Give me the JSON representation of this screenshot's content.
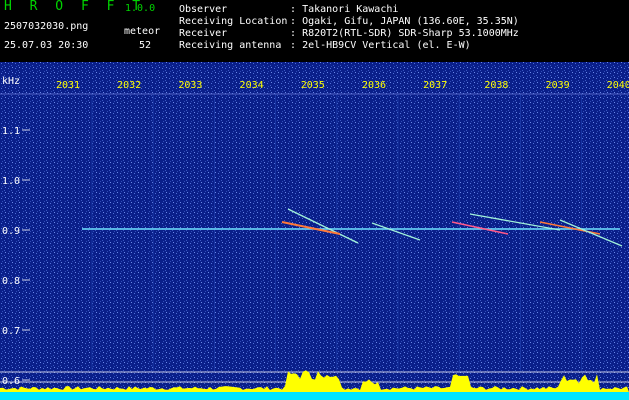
{
  "header": {
    "app_title": "H R O F F T",
    "version": "1.0.0",
    "filename": "2507032030.png",
    "datetime": "25.07.03 20:30",
    "meteor_label": "meteor",
    "meteor_count": "52",
    "info": [
      {
        "label": "Observer",
        "sep": ":",
        "value": "Takanori Kawachi"
      },
      {
        "label": "Receiving Location",
        "sep": ":",
        "value": "Ogaki, Gifu, JAPAN (136.60E, 35.35N)"
      },
      {
        "label": "Receiver",
        "sep": ":",
        "value": "R820T2(RTL-SDR) SDR-Sharp 53.1000MHz"
      },
      {
        "label": "Receiving antenna",
        "sep": ":",
        "value": "2el-HB9CV Vertical (el. E-W)"
      }
    ]
  },
  "spectrogram": {
    "y_unit_label": "kHz",
    "y_ticks": [
      "1.1",
      "1.0",
      "0.9",
      "0.8",
      "0.7",
      "0.6"
    ],
    "x_ticks": [
      "2031",
      "2032",
      "2033",
      "2034",
      "2035",
      "2036",
      "2037",
      "2038",
      "2039",
      "2040"
    ],
    "colors": {
      "background": "#0a1f8a",
      "noise": "#5a7ae0",
      "carrier": "#6fe3ff",
      "tick_text_x": "#ffff00",
      "tick_text_y": "#ffffff",
      "level_bar": "#ffff00",
      "level_base": "#00e5ff"
    }
  }
}
